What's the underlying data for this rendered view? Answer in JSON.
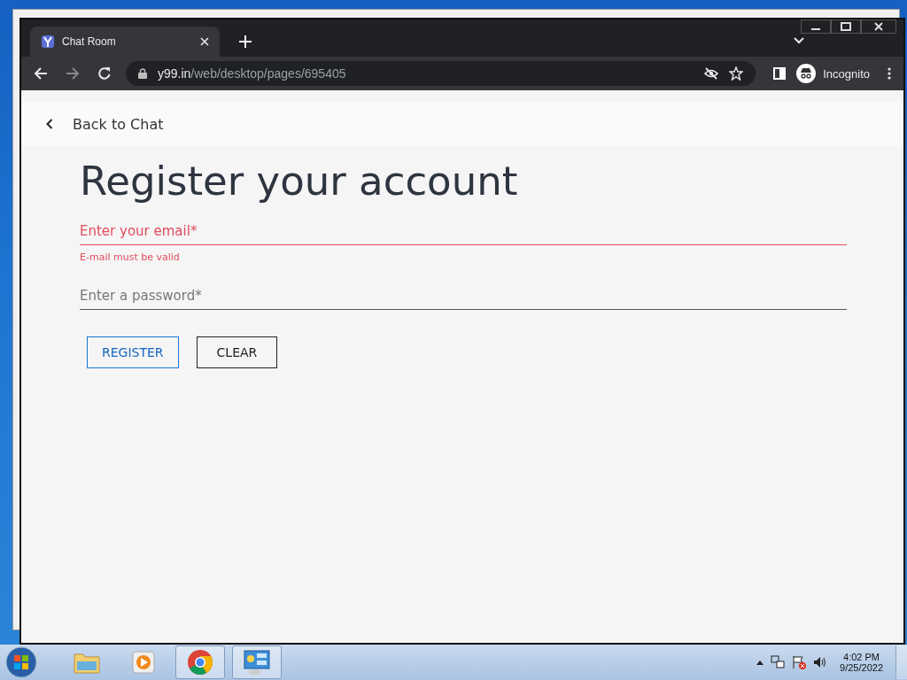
{
  "browser": {
    "tab": {
      "title": "Chat Room"
    },
    "address": {
      "domain": "y99.in",
      "path": "/web/desktop/pages/695405"
    },
    "profile": "Incognito"
  },
  "page": {
    "back_link": "Back to Chat",
    "heading": "Register your account",
    "fields": [
      {
        "placeholder": "Enter your email*",
        "error": "E-mail must be valid",
        "invalid": true
      },
      {
        "placeholder": "Enter a password*",
        "invalid": false
      }
    ],
    "buttons": [
      {
        "label": "REGISTER",
        "kind": "primary"
      },
      {
        "label": "CLEAR",
        "kind": "secondary"
      }
    ]
  },
  "taskbar": {
    "time": "4:02 PM",
    "date": "9/25/2022"
  }
}
